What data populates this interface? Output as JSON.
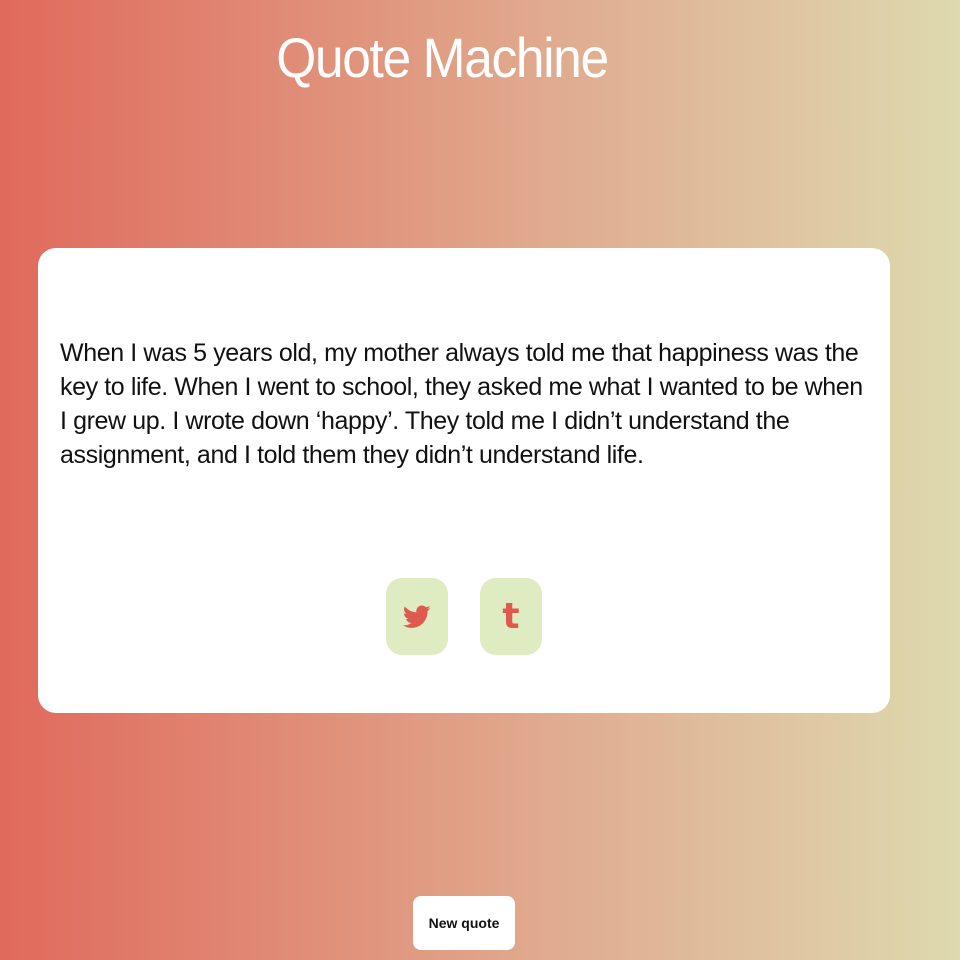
{
  "app": {
    "title": "Quote Machine"
  },
  "quote": {
    "text": "When I was 5 years old, my mother always told me that happiness was the key to life. When I went to school, they asked me what I wanted to be when I grew up. I wrote down ‘happy’. They told me I didn’t understand the assignment, and I told them they didn’t understand life."
  },
  "share": {
    "twitter_icon": "twitter-bird-icon",
    "tumblr_icon": "tumblr-icon",
    "tumblr_glyph": "t"
  },
  "actions": {
    "new_quote_label": "New quote"
  },
  "colors": {
    "gradient_start": "#e06a5c",
    "gradient_end": "#ded9ae",
    "card_background": "#ffffff",
    "icon_button_background": "#dfecc2",
    "icon_color": "#de5a4e"
  }
}
